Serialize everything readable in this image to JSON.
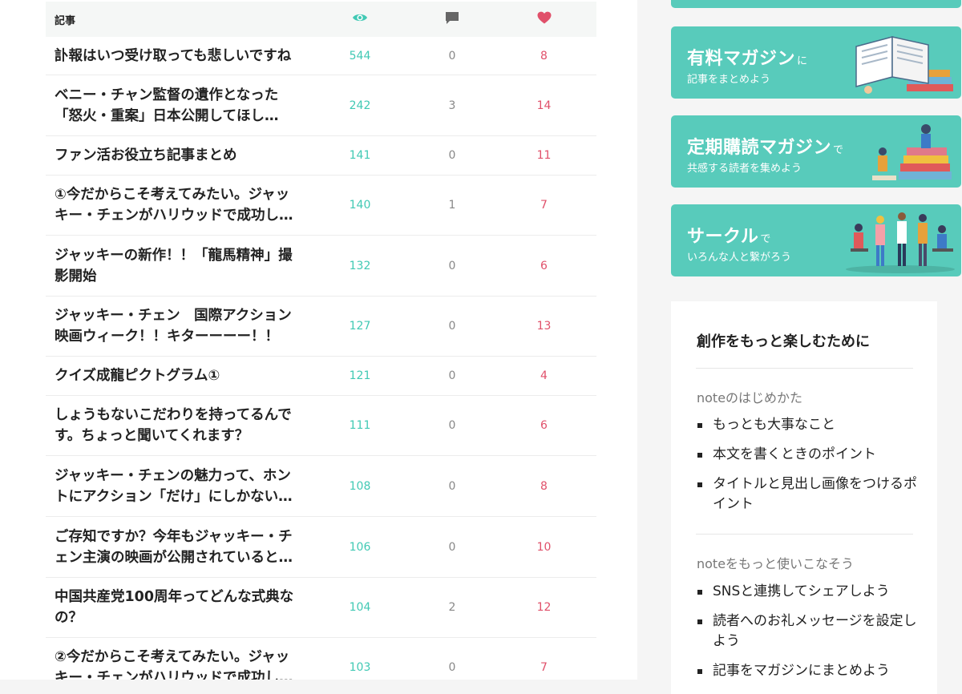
{
  "table": {
    "headers": {
      "title": "記事"
    },
    "rows": [
      {
        "title": [
          "訃報はいつ受け取っても悲しいですね"
        ],
        "views": "544",
        "comments": "0",
        "likes": "8"
      },
      {
        "title": [
          "ベニー・チャン監督の遺作となった",
          "「怒火・重案」日本公開してほし…"
        ],
        "views": "242",
        "comments": "3",
        "likes": "14"
      },
      {
        "title": [
          "ファン活お役立ち記事まとめ"
        ],
        "views": "141",
        "comments": "0",
        "likes": "11"
      },
      {
        "title": [
          "①今だからこそ考えてみたい。ジャッ",
          "キー・チェンがハリウッドで成功し…"
        ],
        "views": "140",
        "comments": "1",
        "likes": "7"
      },
      {
        "title": [
          "ジャッキーの新作！！「龍馬精神」撮",
          "影開始"
        ],
        "views": "132",
        "comments": "0",
        "likes": "6"
      },
      {
        "title": [
          "ジャッキー・チェン　国際アクション",
          "映画ウィーク！！キターーーー！！"
        ],
        "views": "127",
        "comments": "0",
        "likes": "13"
      },
      {
        "title": [
          "クイズ成龍ピクトグラム①"
        ],
        "views": "121",
        "comments": "0",
        "likes": "4"
      },
      {
        "title": [
          "しょうもないこだわりを持ってるんで",
          "す。ちょっと聞いてくれます？"
        ],
        "views": "111",
        "comments": "0",
        "likes": "6"
      },
      {
        "title": [
          "ジャッキー・チェンの魅力って、ホン",
          "トにアクション「だけ」にしかない…"
        ],
        "views": "108",
        "comments": "0",
        "likes": "8"
      },
      {
        "title": [
          "ご存知ですか？今年もジャッキー・チ",
          "ェン主演の映画が公開されていると…"
        ],
        "views": "106",
        "comments": "0",
        "likes": "10"
      },
      {
        "title": [
          "中国共産党100周年ってどんな式典な",
          "の？"
        ],
        "views": "104",
        "comments": "2",
        "likes": "12"
      },
      {
        "title": [
          "②今だからこそ考えてみたい。ジャッ",
          "キー・チェンがハリウッドで成功し…"
        ],
        "views": "103",
        "comments": "0",
        "likes": "7"
      }
    ]
  },
  "banners": [
    {
      "title": "有料マガジン",
      "suffix": "に",
      "subtitle": "記事をまとめよう",
      "illustration": "book-illustration"
    },
    {
      "title": "定期購読マガジン",
      "suffix": "で",
      "subtitle": "共感する読者を集めよう",
      "illustration": "readers-illustration"
    },
    {
      "title": "サークル",
      "suffix": "で",
      "subtitle": "いろんな人と繋がろう",
      "illustration": "people-illustration"
    }
  ],
  "guide": {
    "title": "創作をもっと楽しむために",
    "sections": [
      {
        "title": "noteのはじめかた",
        "items": [
          "もっとも大事なこと",
          "本文を書くときのポイント",
          "タイトルと見出し画像をつけるポイント"
        ]
      },
      {
        "title": "noteをもっと使いこなそう",
        "items": [
          "SNSと連携してシェアしよう",
          "読者へのお礼メッセージを設定しよう",
          "記事をマガジンにまとめよう"
        ]
      }
    ]
  },
  "icons": {
    "views": "eye-icon",
    "comments": "comment-icon",
    "likes": "heart-icon"
  },
  "colors": {
    "accent": "#41c9b4",
    "banner": "#58cbbb",
    "like": "#e0506a",
    "comment": "#888888"
  }
}
